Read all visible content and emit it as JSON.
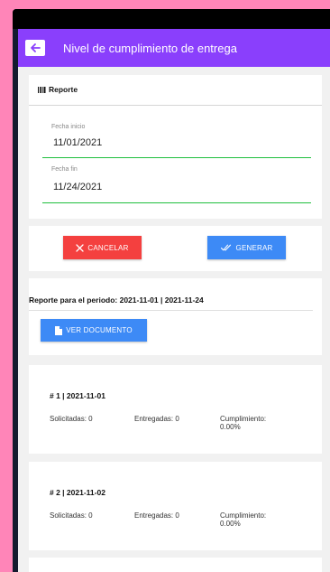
{
  "appbar": {
    "title": "Nivel de cumplimiento de entrega",
    "back_icon": "arrow-left-icon"
  },
  "report": {
    "heading": "Reporte",
    "heading_icon": "barcode-icon",
    "start_label": "Fecha inicio",
    "start_value": "11/01/2021",
    "end_label": "Fecha fin",
    "end_value": "11/24/2021"
  },
  "actions": {
    "cancel_label": "CANCELAR",
    "cancel_icon": "close-icon",
    "generate_label": "GENERAR",
    "generate_icon": "double-check-icon"
  },
  "period": {
    "text": "Reporte para el periodo: 2021-11-01 | 2021-11-24",
    "doc_label": "VER DOCUMENTO",
    "doc_icon": "document-icon"
  },
  "entries": [
    {
      "title": "# 1 | 2021-11-01",
      "solicitadas": "Solicitadas: 0",
      "entregadas": "Entregadas: 0",
      "cumplimiento_label": "Cumplimiento:",
      "cumplimiento_value": "0.00%"
    },
    {
      "title": "# 2 | 2021-11-02",
      "solicitadas": "Solicitadas: 0",
      "entregadas": "Entregadas: 0",
      "cumplimiento_label": "Cumplimiento:",
      "cumplimiento_value": "0.00%"
    }
  ],
  "colors": {
    "appbar": "#8a3ffc",
    "cancel": "#f4403f",
    "primary": "#3d8af6",
    "field_underline": "#1fbf3d",
    "outer_background": "#ff85b8"
  }
}
